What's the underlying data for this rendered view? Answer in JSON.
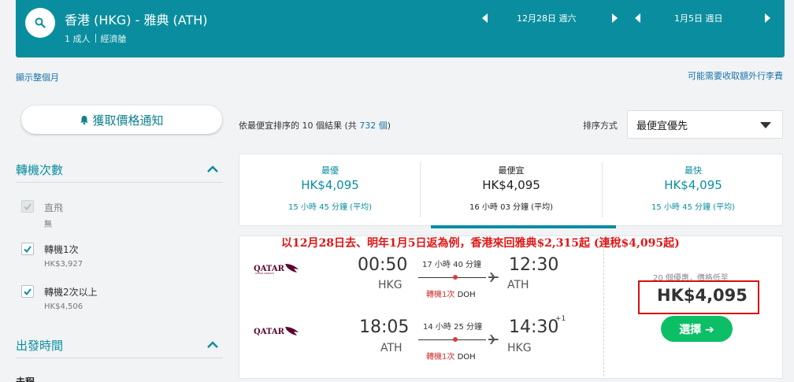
{
  "header": {
    "route": "香港 (HKG) - 雅典 (ATH)",
    "passengers": "1 成人",
    "cabin": "經濟艙",
    "depart_date": "12月28日 週六",
    "return_date": "1月5日 週日",
    "accent_color": "#0a8e9f"
  },
  "links": {
    "show_month": "顯示整個月",
    "baggage_fee": "可能需要收取額外行李費"
  },
  "price_alert": {
    "label": "獲取價格通知"
  },
  "filters": {
    "stops": {
      "title": "轉機次數",
      "options": [
        {
          "label": "直飛",
          "sub": "無",
          "checked": true,
          "disabled": true
        },
        {
          "label": "轉機1次",
          "sub": "HK$3,927",
          "checked": true,
          "disabled": false
        },
        {
          "label": "轉機2次以上",
          "sub": "HK$4,506",
          "checked": true,
          "disabled": false
        }
      ]
    },
    "departure_time": {
      "title": "出發時間",
      "partial_label": "去程"
    }
  },
  "results": {
    "prefix": "依",
    "sort_word": "最便宜",
    "middle": "排序的 10 個結果 (共 ",
    "total": "732 個",
    "suffix": ")",
    "sort_label": "排序方式",
    "sort_value": "最便宜優先"
  },
  "tabs": [
    {
      "title": "最優",
      "price": "HK$4,095",
      "duration": "15 小時 45 分鐘 (平均)",
      "active": false
    },
    {
      "title": "最便宜",
      "price": "HK$4,095",
      "duration": "16 小時 03 分鐘 (平均)",
      "active": true
    },
    {
      "title": "最快",
      "price": "HK$4,095",
      "duration": "15 小時 45 分鐘 (平均)",
      "active": false
    }
  ],
  "promo_text": "以12月28日去、明年1月5日返為例，香港來回雅典$2,315起 (連稅$4,095起)",
  "flight": {
    "airline": "QATAR AIRWAYS",
    "outbound": {
      "dep_time": "00:50",
      "dep_code": "HKG",
      "arr_time": "12:30",
      "arr_code": "ATH",
      "duration": "17 小時 40 分鐘",
      "stops": "轉機1次",
      "via": "DOH"
    },
    "inbound": {
      "dep_time": "18:05",
      "dep_code": "ATH",
      "arr_time": "14:30",
      "arr_code": "HKG",
      "day_offset": "+1",
      "duration": "14 小時 25 分鐘",
      "stops": "轉機1次",
      "via": "DOH"
    },
    "deals": "20 個優惠，價格低至",
    "price": "HK$4,095",
    "select_label": "選擇 ➔"
  }
}
